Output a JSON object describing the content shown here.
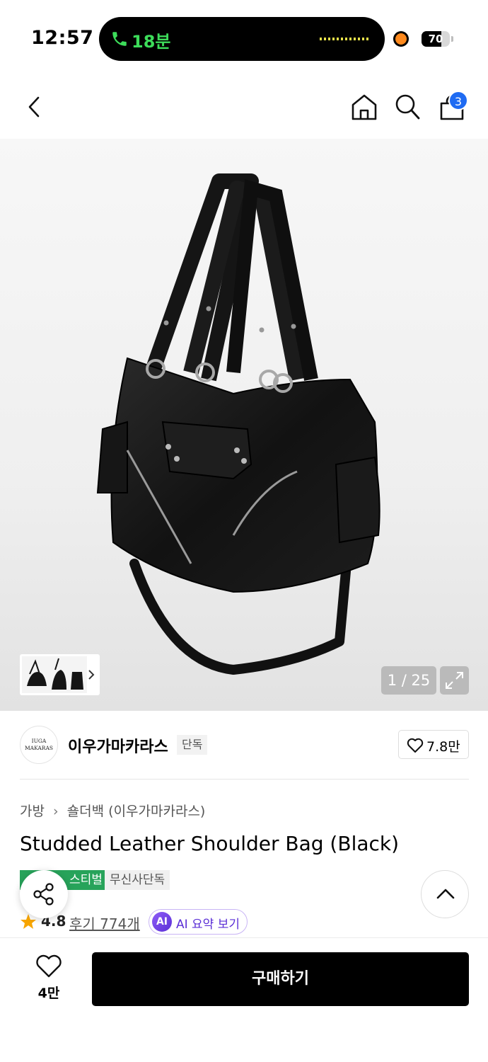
{
  "status_bar": {
    "time": "12:57",
    "call_label": "18분",
    "battery": "70",
    "battery_level": 0.7
  },
  "nav": {
    "cart_count": "3"
  },
  "gallery": {
    "counter": "1 / 25"
  },
  "brand": {
    "logo_text_line1": "IUGA",
    "logo_text_line2": "MAKARAS",
    "name": "이우가마카라스",
    "tag": "단독",
    "like_count": "7.8만"
  },
  "product": {
    "breadcrumb": [
      "가방",
      "숄더백 (이우가마카라스)"
    ],
    "title": "Studded Leather Shoulder Bag (Black)",
    "badges": [
      "스티벌",
      "무신사단독"
    ],
    "rating": "4.8",
    "reviews_label": "후기 774개",
    "ai_badge": "AI",
    "ai_label": "AI 요약 보기"
  },
  "bottom_bar": {
    "wish_count": "4만",
    "buy_label": "구매하기"
  },
  "colors": {
    "accent_blue": "#1f6bf2",
    "badge_green": "#27a35a",
    "ai_purple": "#5b2fd6",
    "star": "#f7a500"
  }
}
